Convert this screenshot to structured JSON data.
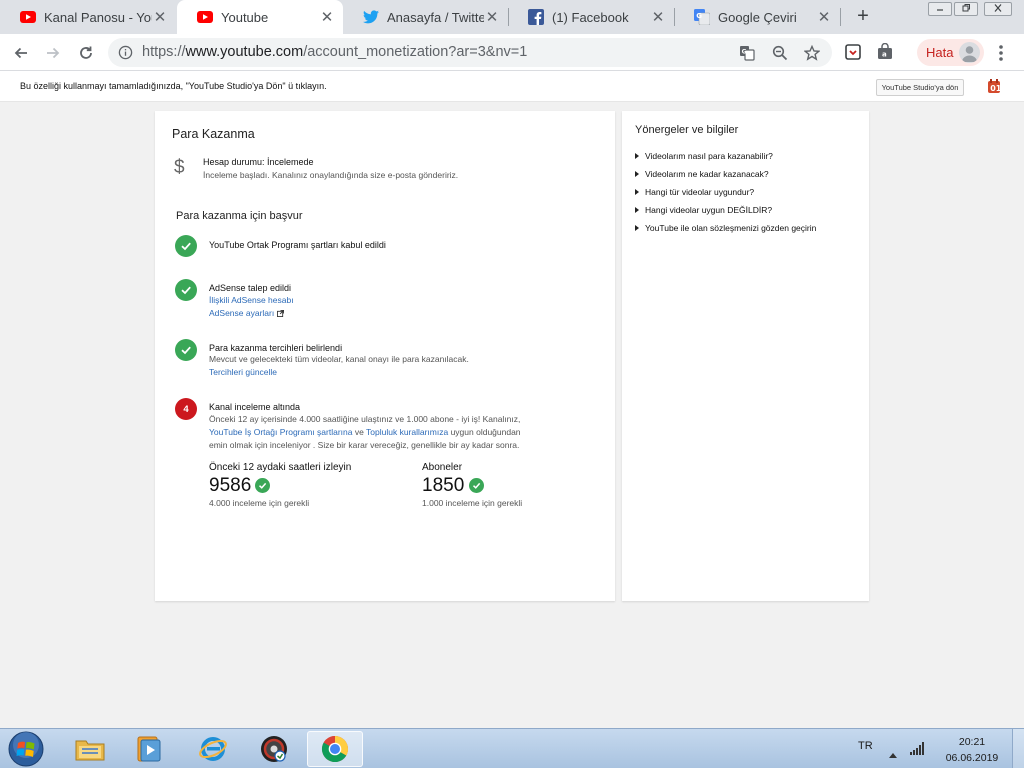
{
  "browser": {
    "tabs": [
      {
        "title": "Kanal Panosu - You",
        "icon": "youtube-icon",
        "active": false
      },
      {
        "title": "Youtube",
        "icon": "youtube-icon",
        "active": true
      },
      {
        "title": "Anasayfa / Twitter",
        "icon": "twitter-icon",
        "active": false
      },
      {
        "title": "(1) Facebook",
        "icon": "facebook-icon",
        "active": false
      },
      {
        "title": "Google Çeviri",
        "icon": "google-translate-icon",
        "active": false
      }
    ],
    "tab_close_glyph": "✕",
    "new_tab_glyph": "+",
    "address": {
      "scheme": "https://",
      "host": "www.youtube.com",
      "path": "/account_monetization?ar=3&nv=1"
    },
    "profile_label": "Hata",
    "accent_color": "#c5221f"
  },
  "notice": {
    "text": "Bu özelliği kullanmayı tamamladığınızda, \"YouTube Studio'ya Dön\" ü tıklayın.",
    "button": "YouTube Studio'ya dön"
  },
  "main": {
    "title": "Para Kazanma",
    "status": {
      "icon": "dollar-icon",
      "symbol": "$",
      "label": "Hesap durumu: İncelemede",
      "desc": "İnceleme başladı. Kanalınız onaylandığında size e-posta göndeririz."
    },
    "apply_heading": "Para kazanma için başvur",
    "steps": [
      {
        "title": "YouTube Ortak Programı şartları kabul edildi",
        "status": "done"
      },
      {
        "title": "AdSense talep edildi",
        "status": "done",
        "link1": "İlişkili AdSense hesabı",
        "link2": "AdSense ayarları"
      },
      {
        "title": "Para kazanma tercihleri belirlendi",
        "status": "done",
        "desc": "Mevcut ve gelecekteki tüm videolar, kanal onayı ile para kazanılacak.",
        "link1": "Tercihleri güncelle"
      },
      {
        "title": "Kanal inceleme altında",
        "status": "pending",
        "number": "4",
        "line1": "Önceki 12 ay içerisinde 4.000 saatliğine ulaştınız ve 1.000 abone - iyi iş! Kanalınız,",
        "line2_link1": "YouTube İş Ortağı Programı şartlarına",
        "line2_mid": " ve ",
        "line2_link2": "Topluluk kurallarımıza",
        "line2_end": " uygun olduğundan",
        "line3": "emin olmak için inceleniyor . Size bir karar vereceğiz, genellikle bir ay kadar sonra."
      }
    ],
    "stats": [
      {
        "label": "Önceki 12 aydaki saatleri izleyin",
        "value": "9586",
        "note": "4.000 inceleme için gerekli"
      },
      {
        "label": "Aboneler",
        "value": "1850",
        "note": "1.000 inceleme için gerekli"
      }
    ],
    "check_color": "#3aa757",
    "pending_color": "#cc181e",
    "link_color": "#2d6bb8"
  },
  "sidebar": {
    "title": "Yönergeler ve bilgiler",
    "items": [
      "Videolarım nasıl para kazanabilir?",
      "Videolarım ne kadar kazanacak?",
      "Hangi tür videolar uygundur?",
      "Hangi videolar uygun DEĞİLDİR?",
      "YouTube ile olan sözleşmenizi gözden geçirin"
    ]
  },
  "taskbar": {
    "apps": [
      "explorer-icon",
      "media-player-icon",
      "internet-explorer-icon",
      "app-icon",
      "chrome-icon"
    ],
    "lang": "TR",
    "time": "20:21",
    "date": "06.06.2019"
  }
}
